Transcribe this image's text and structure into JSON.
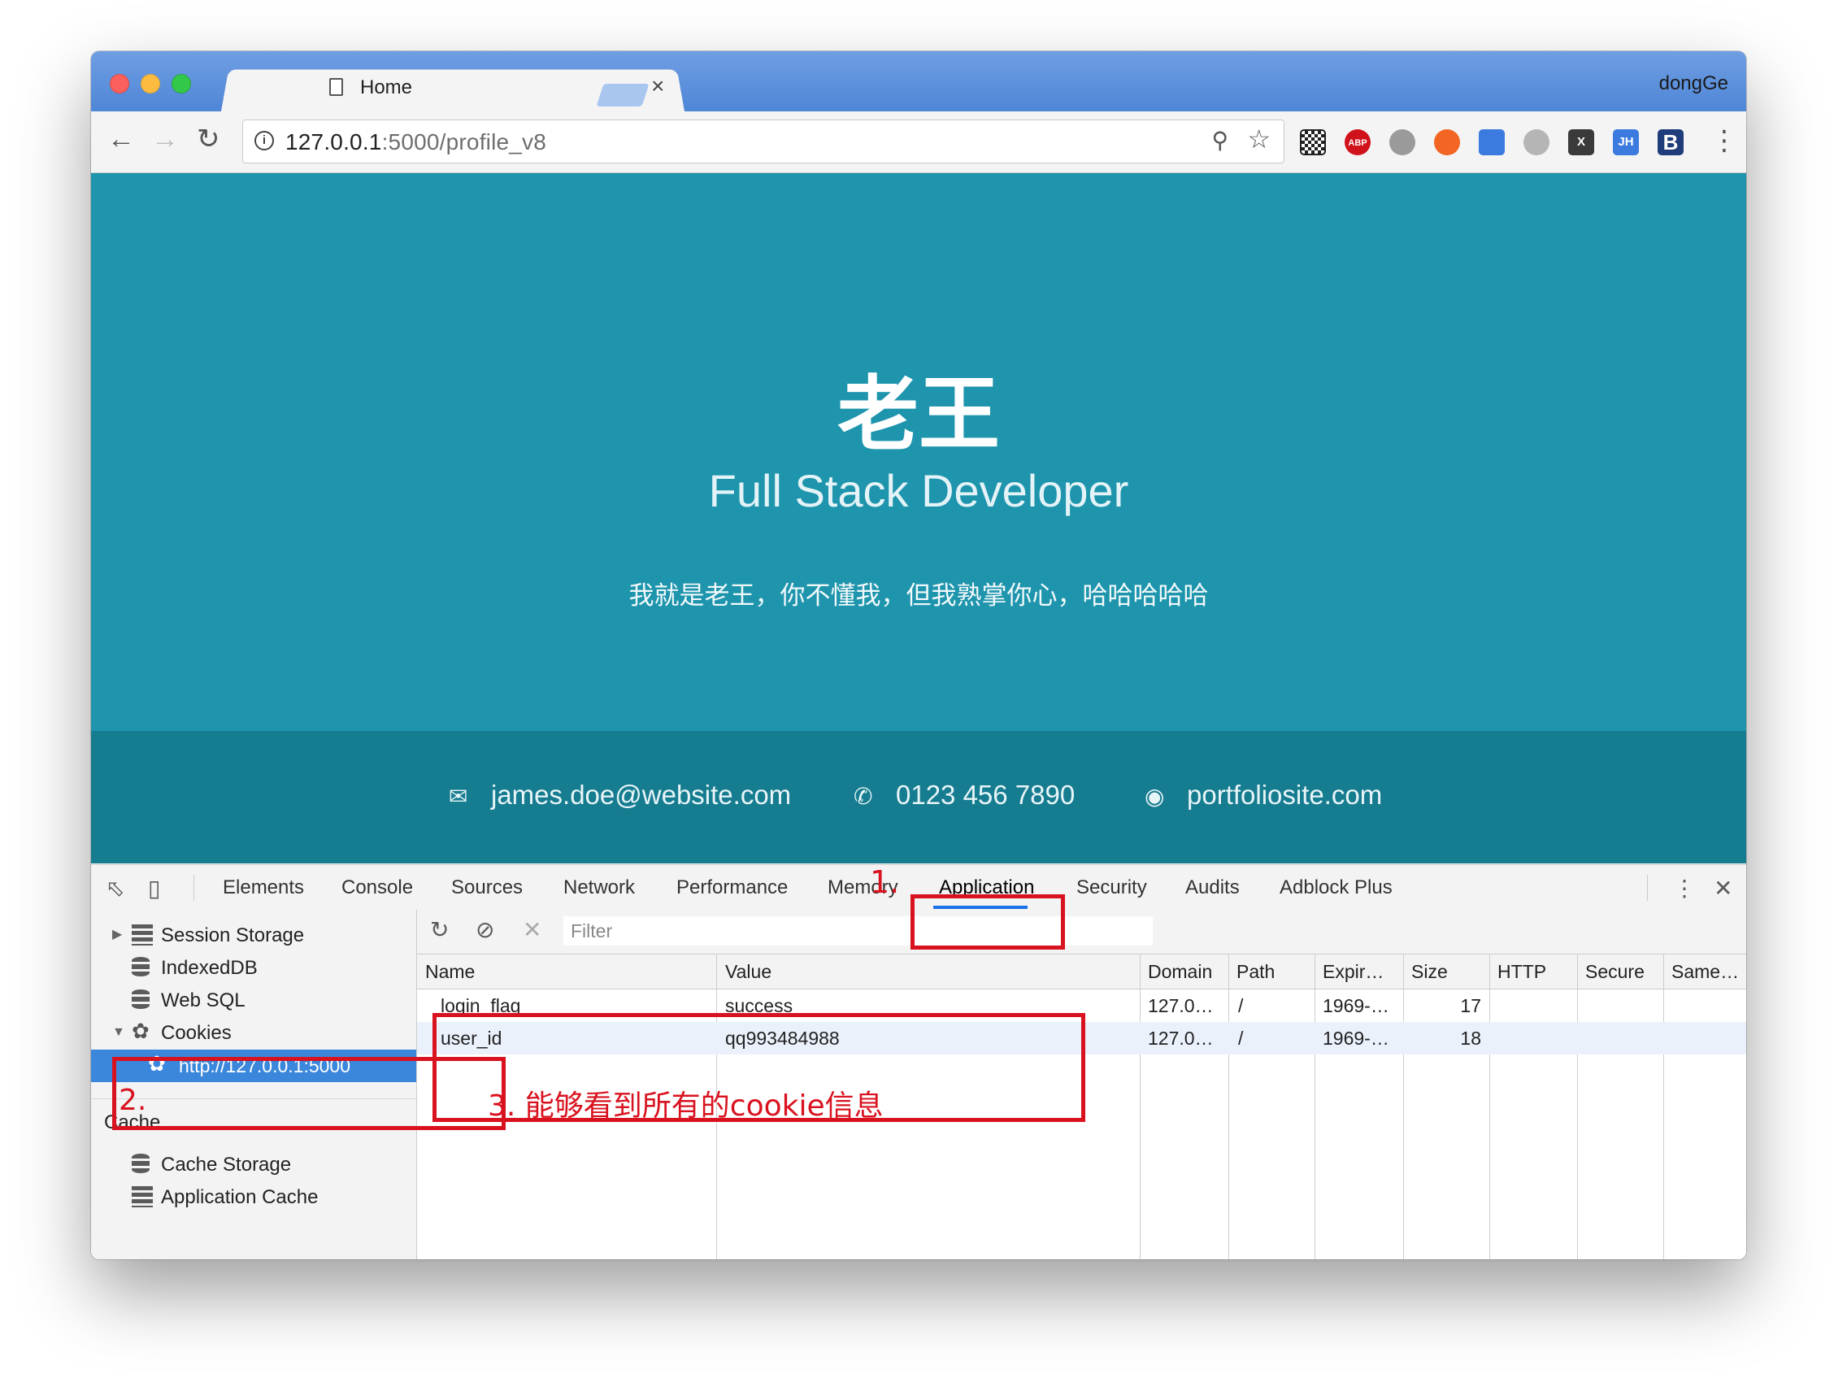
{
  "browser": {
    "tab_title": "Home",
    "tab_close": "×",
    "profile_name": "dongGe",
    "url_host": "127.0.0.1",
    "url_path": ":5000/profile_v8",
    "extensions": [
      {
        "name": "qr-code-icon",
        "label": "",
        "color": "#222222"
      },
      {
        "name": "adblock-plus-icon",
        "label": "ABP",
        "color": "#d0121a"
      },
      {
        "name": "globe-icon",
        "label": "",
        "color": "#9a9a9a"
      },
      {
        "name": "lifebuoy-icon",
        "label": "",
        "color": "#f26522"
      },
      {
        "name": "translate-icon",
        "label": "",
        "color": "#3b7be0"
      },
      {
        "name": "earth-icon",
        "label": "",
        "color": "#b5b5b5"
      },
      {
        "name": "x-extension-icon",
        "label": "X",
        "color": "#3a3a3a"
      },
      {
        "name": "jh-extension-icon",
        "label": "JH",
        "color": "#3b7be0"
      },
      {
        "name": "bold-b-extension-icon",
        "label": "B",
        "color": "#1f3d7a"
      }
    ]
  },
  "hero": {
    "name": "老王",
    "role": "Full Stack Developer",
    "bio": "我就是老王，你不懂我，但我熟掌你心，哈哈哈哈哈"
  },
  "contacts": [
    {
      "icon": "envelope-icon",
      "text": "james.doe@website.com"
    },
    {
      "icon": "phone-icon",
      "text": "0123 456 7890"
    },
    {
      "icon": "globe-icon",
      "text": "portfoliosite.com"
    }
  ],
  "devtools": {
    "tabs": [
      "Elements",
      "Console",
      "Sources",
      "Network",
      "Performance",
      "Memory",
      "Application",
      "Security",
      "Audits",
      "Adblock Plus"
    ],
    "active_tab": "Application",
    "sidebar": {
      "storage_items": [
        "Session Storage",
        "IndexedDB",
        "Web SQL",
        "Cookies"
      ],
      "cookie_origin": "http://127.0.0.1:5000",
      "cache_section": "Cache",
      "cache_items": [
        "Cache Storage",
        "Application Cache"
      ]
    },
    "filter_placeholder": "Filter",
    "columns": [
      "Name",
      "Value",
      "Domain",
      "Path",
      "Expir…",
      "Size",
      "HTTP",
      "Secure",
      "Same…"
    ],
    "rows": [
      {
        "name": "login_flag",
        "value": "success",
        "domain": "127.0…",
        "path": "/",
        "expires": "1969-…",
        "size": "17"
      },
      {
        "name": "user_id",
        "value": "qq993484988",
        "domain": "127.0…",
        "path": "/",
        "expires": "1969-…",
        "size": "18"
      }
    ]
  },
  "annotations": {
    "step1": "1.",
    "step2": "2.",
    "step3": "3. 能够看到所有的cookie信息",
    "color": "#d9121f"
  }
}
